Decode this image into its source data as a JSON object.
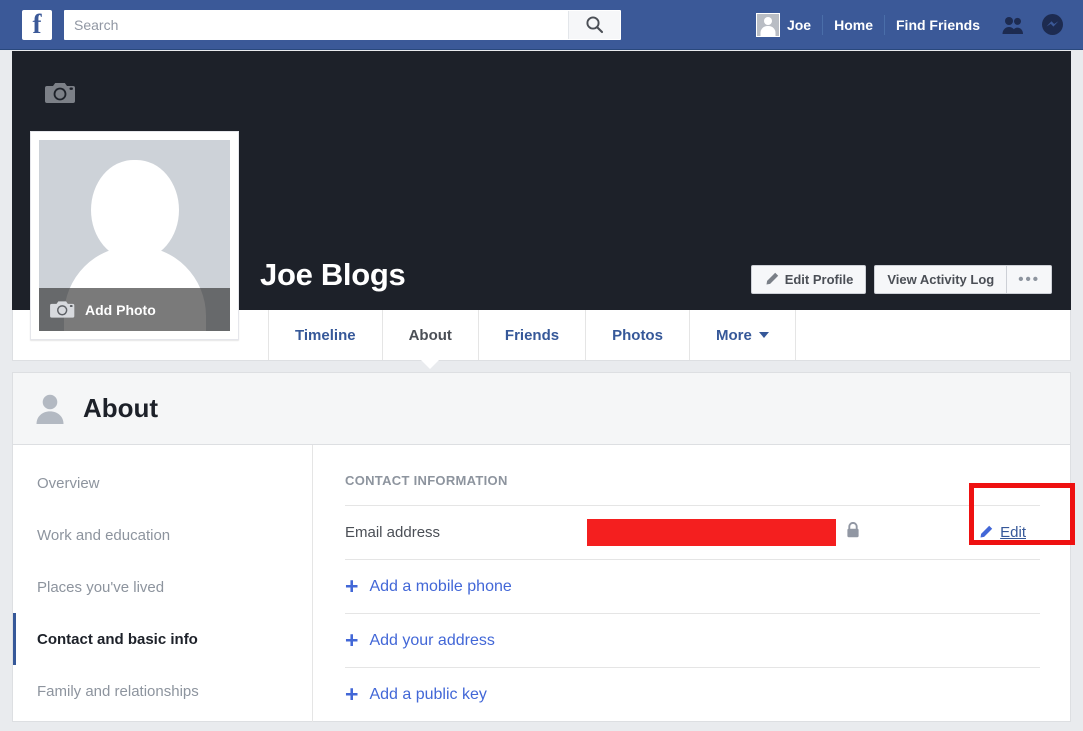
{
  "topbar": {
    "logo": "f",
    "search": {
      "placeholder": "Search",
      "value": "",
      "icon": "search-icon"
    },
    "user_name": "Joe",
    "home_label": "Home",
    "find_friends_label": "Find Friends",
    "friends_icon": "friends-icon",
    "messenger_icon": "messenger-icon",
    "bg_color": "#3b5998"
  },
  "cover": {
    "camera_icon": "camera-icon",
    "bg_color": "#1d2129",
    "profile_name": "Joe Blogs",
    "edit_profile_label": "Edit Profile",
    "edit_profile_icon": "pencil-icon",
    "view_activity_log_label": "View Activity Log",
    "more_options_label": "•••"
  },
  "profile_picture": {
    "add_photo_label": "Add Photo",
    "camera_icon": "camera-icon",
    "avatar_icon": "default-avatar-silhouette"
  },
  "tabs": [
    {
      "label": "Timeline",
      "active": false
    },
    {
      "label": "About",
      "active": true
    },
    {
      "label": "Friends",
      "active": false
    },
    {
      "label": "Photos",
      "active": false
    },
    {
      "label": "More",
      "active": false,
      "has_caret": true
    }
  ],
  "about": {
    "title": "About",
    "title_icon": "person-icon",
    "sidebar": [
      {
        "label": "Overview",
        "active": false
      },
      {
        "label": "Work and education",
        "active": false
      },
      {
        "label": "Places you've lived",
        "active": false
      },
      {
        "label": "Contact and basic info",
        "active": true
      },
      {
        "label": "Family and relationships",
        "active": false
      }
    ],
    "section_label": "CONTACT INFORMATION",
    "email_row": {
      "label": "Email address",
      "value_redacted": true,
      "redaction_color": "#f41f1f",
      "privacy_icon": "lock-icon",
      "edit_label": "Edit",
      "edit_icon": "pencil-icon",
      "highlighted": true,
      "highlight_color": "#ee1111"
    },
    "add_rows": [
      {
        "label": "Add a mobile phone",
        "icon": "plus-icon"
      },
      {
        "label": "Add your address",
        "icon": "plus-icon"
      },
      {
        "label": "Add a public key",
        "icon": "plus-icon"
      }
    ]
  }
}
